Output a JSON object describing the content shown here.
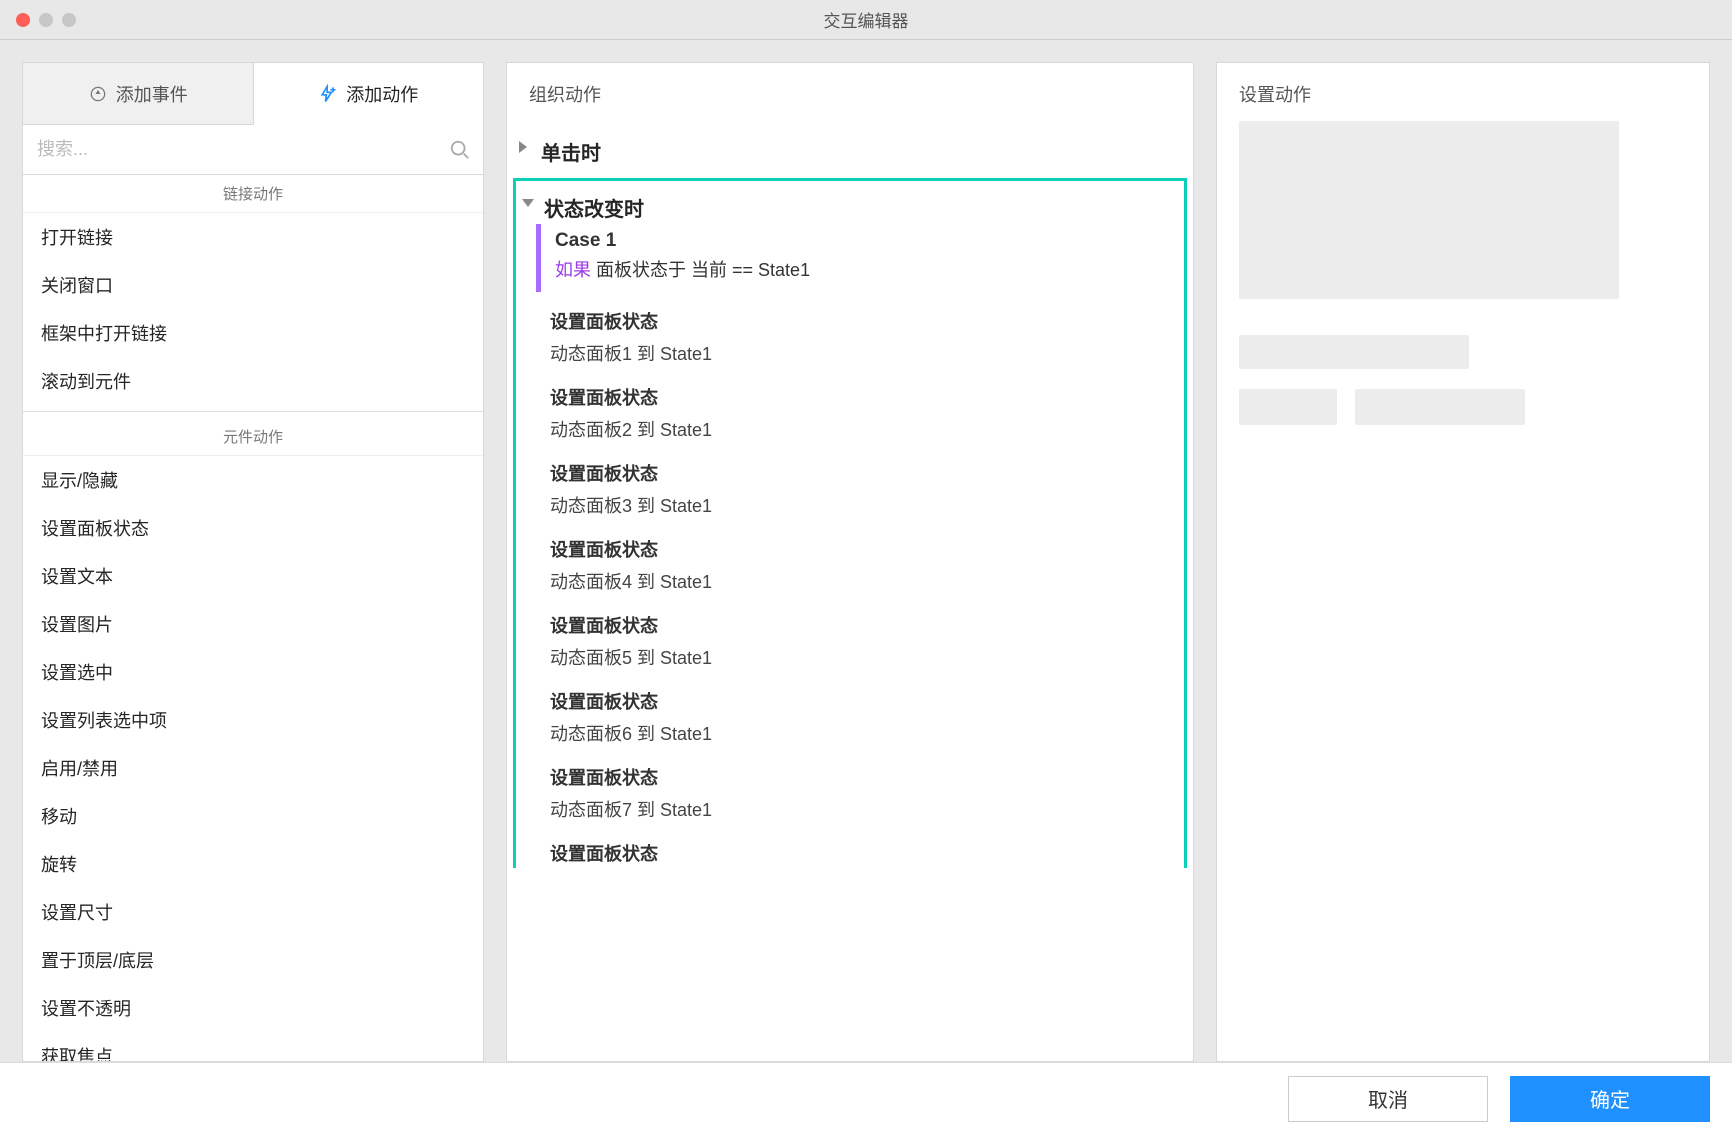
{
  "window": {
    "title": "交互编辑器"
  },
  "left": {
    "tabs": {
      "add_event": "添加事件",
      "add_action": "添加动作"
    },
    "search_placeholder": "搜索...",
    "sections": {
      "link_label": "链接动作",
      "link_items": [
        "打开链接",
        "关闭窗口",
        "框架中打开链接",
        "滚动到元件"
      ],
      "widget_label": "元件动作",
      "widget_items": [
        "显示/隐藏",
        "设置面板状态",
        "设置文本",
        "设置图片",
        "设置选中",
        "设置列表选中项",
        "启用/禁用",
        "移动",
        "旋转",
        "设置尺寸",
        "置于顶层/底层",
        "设置不透明",
        "获取焦点"
      ]
    }
  },
  "mid": {
    "header": "组织动作",
    "events": [
      {
        "label": "单击时",
        "expanded": false,
        "selected": false
      },
      {
        "label": "状态改变时",
        "expanded": true,
        "selected": true,
        "case": {
          "title": "Case 1",
          "cond_kw": "如果",
          "cond_rest": "面板状态于 当前 == State1"
        },
        "actions": [
          {
            "title": "设置面板状态",
            "detail": "动态面板1 到 State1"
          },
          {
            "title": "设置面板状态",
            "detail": "动态面板2 到 State1"
          },
          {
            "title": "设置面板状态",
            "detail": "动态面板3 到 State1"
          },
          {
            "title": "设置面板状态",
            "detail": "动态面板4 到 State1"
          },
          {
            "title": "设置面板状态",
            "detail": "动态面板5 到 State1"
          },
          {
            "title": "设置面板状态",
            "detail": "动态面板6 到 State1"
          },
          {
            "title": "设置面板状态",
            "detail": "动态面板7 到 State1"
          },
          {
            "title": "设置面板状态",
            "detail": ""
          }
        ]
      }
    ]
  },
  "right": {
    "header": "设置动作"
  },
  "footer": {
    "cancel": "取消",
    "ok": "确定"
  },
  "colors": {
    "accent": "#08d1b8",
    "primary": "#1e90ff",
    "condition": "#9a3be6"
  }
}
